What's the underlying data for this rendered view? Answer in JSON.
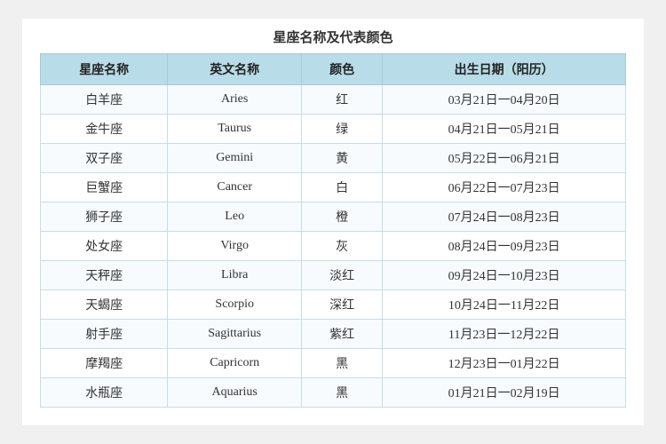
{
  "title": "星座名称及代表颜色",
  "headers": [
    "星座名称",
    "英文名称",
    "颜色",
    "出生日期（阳历）"
  ],
  "rows": [
    {
      "chinese": "白羊座",
      "english": "Aries",
      "color": "红",
      "date": "03月21日一04月20日"
    },
    {
      "chinese": "金牛座",
      "english": "Taurus",
      "color": "绿",
      "date": "04月21日一05月21日"
    },
    {
      "chinese": "双子座",
      "english": "Gemini",
      "color": "黄",
      "date": "05月22日一06月21日"
    },
    {
      "chinese": "巨蟹座",
      "english": "Cancer",
      "color": "白",
      "date": "06月22日一07月23日"
    },
    {
      "chinese": "狮子座",
      "english": "Leo",
      "color": "橙",
      "date": "07月24日一08月23日"
    },
    {
      "chinese": "处女座",
      "english": "Virgo",
      "color": "灰",
      "date": "08月24日一09月23日"
    },
    {
      "chinese": "天秤座",
      "english": "Libra",
      "color": "淡红",
      "date": "09月24日一10月23日"
    },
    {
      "chinese": "天蝎座",
      "english": "Scorpio",
      "color": "深红",
      "date": "10月24日一11月22日"
    },
    {
      "chinese": "射手座",
      "english": "Sagittarius",
      "color": "紫红",
      "date": "11月23日一12月22日"
    },
    {
      "chinese": "摩羯座",
      "english": "Capricorn",
      "color": "黑",
      "date": "12月23日一01月22日"
    },
    {
      "chinese": "水瓶座",
      "english": "Aquarius",
      "color": "黑",
      "date": "01月21日一02月19日"
    }
  ]
}
